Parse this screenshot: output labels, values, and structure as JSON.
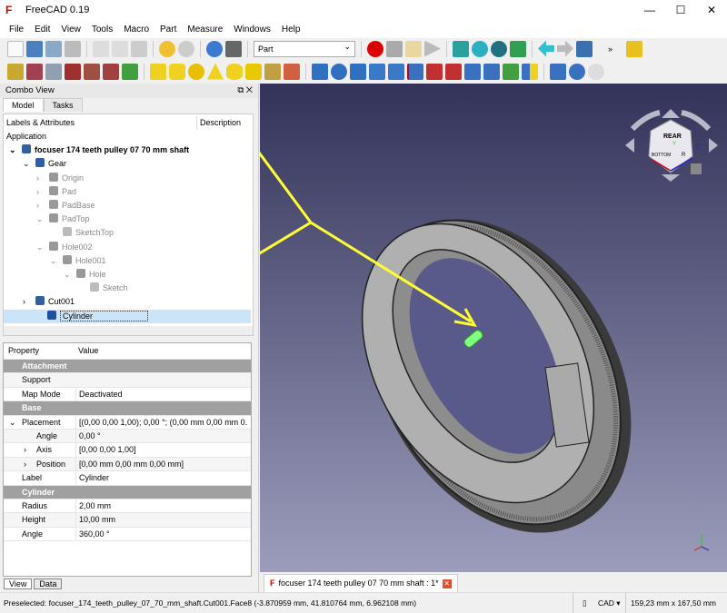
{
  "window": {
    "title": "FreeCAD 0.19",
    "minimize": "—",
    "maximize": "☐",
    "close": "✕"
  },
  "menu": [
    "File",
    "Edit",
    "View",
    "Tools",
    "Macro",
    "Part",
    "Measure",
    "Windows",
    "Help"
  ],
  "toolbar": {
    "workbench": "Part",
    "overflow": "»"
  },
  "combo": {
    "title": "Combo View",
    "tabs": [
      "Model",
      "Tasks"
    ],
    "col_labels": "Labels & Attributes",
    "col_desc": "Description",
    "tree": [
      {
        "label": "Application",
        "depth": 0,
        "style": "normal"
      },
      {
        "label": "focuser 174 teeth pulley 07 70 mm shaft",
        "depth": 1,
        "expander": "⌄",
        "style": "bold",
        "icon_color": "#3060a0"
      },
      {
        "label": "Gear",
        "depth": 2,
        "expander": "⌄",
        "style": "normal",
        "icon_color": "#2f5fa8"
      },
      {
        "label": "Origin",
        "depth": 3,
        "expander": "›",
        "style": "grey",
        "icon_color": "#999"
      },
      {
        "label": "Pad",
        "depth": 3,
        "expander": "›",
        "style": "grey",
        "icon_color": "#999"
      },
      {
        "label": "PadBase",
        "depth": 3,
        "expander": "›",
        "style": "grey",
        "icon_color": "#999"
      },
      {
        "label": "PadTop",
        "depth": 3,
        "expander": "⌄",
        "style": "grey",
        "icon_color": "#999"
      },
      {
        "label": "SketchTop",
        "depth": 4,
        "style": "grey",
        "icon_color": "#bbb"
      },
      {
        "label": "Hole002",
        "depth": 3,
        "expander": "⌄",
        "style": "grey",
        "icon_color": "#999"
      },
      {
        "label": "Hole001",
        "depth": 4,
        "expander": "⌄",
        "style": "grey",
        "icon_color": "#999"
      },
      {
        "label": "Hole",
        "depth": 5,
        "expander": "⌄",
        "style": "grey",
        "icon_color": "#999"
      },
      {
        "label": "Sketch",
        "depth": 6,
        "style": "grey",
        "icon_color": "#bbb"
      },
      {
        "label": "Cut001",
        "depth": 2,
        "expander": "›",
        "style": "normal",
        "icon_color": "#3060a0"
      },
      {
        "label": "Cylinder",
        "depth": 2,
        "style": "selected",
        "icon_color": "#2050a0"
      }
    ]
  },
  "properties": {
    "col_property": "Property",
    "col_value": "Value",
    "rows": [
      {
        "type": "group",
        "key": "Attachment"
      },
      {
        "key": "Support",
        "value": ""
      },
      {
        "key": "Map Mode",
        "value": "Deactivated"
      },
      {
        "type": "group",
        "key": "Base"
      },
      {
        "key": "Placement",
        "value": "[(0,00 0,00 1,00); 0,00 °; (0,00 mm  0,00 mm  0...",
        "expander": "⌄"
      },
      {
        "key": "Angle",
        "value": "0,00 °",
        "indent": 1
      },
      {
        "key": "Axis",
        "value": "[0,00 0,00 1,00]",
        "indent": 1,
        "expander": "›"
      },
      {
        "key": "Position",
        "value": "[0,00 mm  0,00 mm  0,00 mm]",
        "indent": 1,
        "expander": "›"
      },
      {
        "key": "Label",
        "value": "Cylinder"
      },
      {
        "type": "group",
        "key": "Cylinder"
      },
      {
        "key": "Radius",
        "value": "2,00 mm"
      },
      {
        "key": "Height",
        "value": "10,00 mm"
      },
      {
        "key": "Angle",
        "value": "360,00 °"
      }
    ]
  },
  "bottom_tabs": [
    "View",
    "Data"
  ],
  "document_tab": "focuser 174 teeth pulley 07 70 mm shaft : 1*",
  "navcube": {
    "top": "REAR",
    "left": "BOTTOM",
    "right": "R",
    "axis_z": "Z",
    "axis_y": "Y"
  },
  "status": {
    "preselected": "Preselected: focuser_174_teeth_pulley_07_70_mm_shaft.Cut001.Face8 (-3.870959 mm, 41.810764 mm, 6.962108 mm)",
    "nav_style": "CAD ▾",
    "dimensions": "159,23 mm x 167,50 mm"
  },
  "colors": {
    "viewport_top": "#33335a",
    "viewport_bottom": "#9c9cbc",
    "annotation_arrow": "#ffff33",
    "cylinder": "#80ff80",
    "selection": "#cce4f7"
  }
}
